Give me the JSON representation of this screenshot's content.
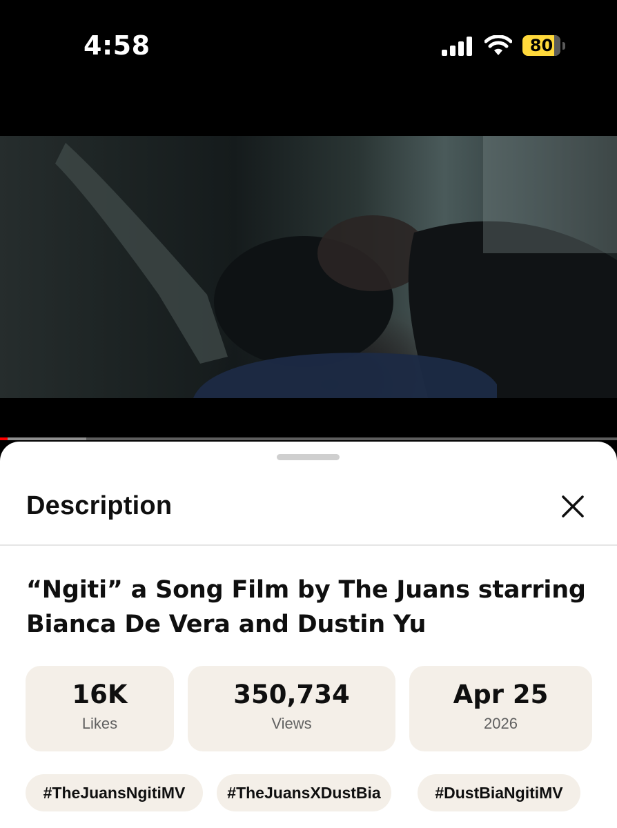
{
  "status_bar": {
    "time": "4:58",
    "battery_level": "80",
    "battery_color": "#ffd93b"
  },
  "video": {
    "progress_percent": 1.2,
    "buffered_percent": 14
  },
  "description_sheet": {
    "title": "Description",
    "video_title": "“Ngiti” a Song Film by The Juans starring Bianca De Vera and Dustin Yu",
    "stats": {
      "likes": {
        "value": "16K",
        "label": "Likes"
      },
      "views": {
        "value": "350,734",
        "label": "Views"
      },
      "date": {
        "value": "Apr 25",
        "label": "2026"
      }
    },
    "hashtags": [
      "#TheJuansNgitiMV",
      "#TheJuansXDustBia",
      "#DustBiaNgitiMV"
    ]
  },
  "colors": {
    "chip_background": "#f4efe8",
    "progress_red": "#ff0000"
  }
}
